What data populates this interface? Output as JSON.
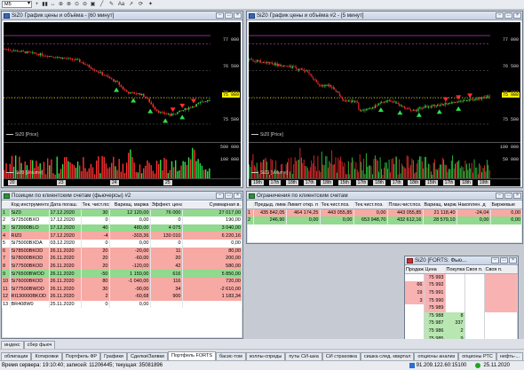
{
  "toolbar": {
    "interval": "M5",
    "tools": [
      "+",
      "▮▮",
      "↔",
      "⊕",
      "⊗",
      "⊙",
      "⊖",
      "▣",
      "╱",
      "✎",
      "Aa",
      "↗",
      "⟳",
      "✦"
    ]
  },
  "colors": {
    "bull": "#2ee04a",
    "bear": "#ff3030",
    "up_row": "#91d98e",
    "down_row": "#f7a9a4",
    "marker": "#fff200",
    "dash_line": "#c04bd0"
  },
  "chart1": {
    "title": "SiZ0 График цены и объёма - [60 минут]",
    "y_ticks": [
      "77 000",
      "76 500",
      "76 000",
      "75 500"
    ],
    "y_tag": "75 989",
    "legend_price": "SiZ0 [Price]",
    "volume_label": "SiZ0 [Volume]",
    "vol_ticks": [
      "500 000",
      "100 000"
    ],
    "x_labels": [
      "20",
      "23",
      "24",
      "25"
    ],
    "chart_data": {
      "type": "candlestick",
      "instrument": "SiZ0",
      "interval": "60 минут",
      "ylim": [
        75300,
        77300
      ],
      "x": [
        "20",
        "23",
        "24",
        "25"
      ],
      "last": 75989
    }
  },
  "chart2": {
    "title": "SiZ0 График цены и объёма #2 - [5 минут]",
    "y_ticks": [
      "77 000",
      "76 500",
      "76 000",
      "75 500"
    ],
    "y_tag": "75 988",
    "legend_price": "SiZ0 [Price]",
    "volume_label": "SiZ0 [Volume]",
    "vol_ticks": [
      "100 000",
      "50 000"
    ],
    "x_labels": [
      "19th",
      "17th",
      "18th",
      "17th",
      "18th",
      "15th",
      "17th",
      "18th",
      "17th",
      "18th",
      "15th",
      "17th",
      "18th",
      "19th"
    ],
    "chart_data": {
      "type": "candlestick",
      "instrument": "SiZ0",
      "interval": "5 минут",
      "ylim": [
        75300,
        77300
      ],
      "last": 75988
    }
  },
  "positions": {
    "title": "Позиции по клиентским счетам (фьючерсы) #2",
    "columns": [
      "Код инструмента",
      "Дата погаш.",
      "Тек. чист.поз.",
      "Вариац. маржа",
      "Эффект. цена",
      "Суммарная в."
    ],
    "rows": [
      {
        "n": "1",
        "code": "SiZ0",
        "date": "17.12.2020",
        "pos": "30",
        "vm": "12 120,00",
        "eff": "76 000",
        "sum": "27 017,00",
        "cls": "g"
      },
      {
        "n": "2",
        "code": "Si72500BXO",
        "date": "17.12.2020",
        "pos": "0",
        "vm": "0,00",
        "eff": "0",
        "sum": "190,00",
        "cls": "w"
      },
      {
        "n": "3",
        "code": "Si72000BLO",
        "date": "17.12.2020",
        "pos": "40",
        "vm": "480,00",
        "eff": "4 075",
        "sum": "3 040,00",
        "cls": "g"
      },
      {
        "n": "4",
        "code": "RIZ0",
        "date": "17.12.2020",
        "pos": "-4",
        "vm": "-303,36",
        "eff": "130 010",
        "sum": "6 220,16",
        "cls": "r"
      },
      {
        "n": "5",
        "code": "Si75000BXDA",
        "date": "03.12.2020",
        "pos": "0",
        "vm": "0,00",
        "eff": "0",
        "sum": "0,00",
        "cls": "w"
      },
      {
        "n": "6",
        "code": "Si78500BKOD",
        "date": "26.11.2020",
        "pos": "20",
        "vm": "-20,00",
        "eff": "11",
        "sum": "80,00",
        "cls": "r"
      },
      {
        "n": "7",
        "code": "Si78000BKOD",
        "date": "26.11.2020",
        "pos": "20",
        "vm": "-60,00",
        "eff": "20",
        "sum": "200,00",
        "cls": "r"
      },
      {
        "n": "8",
        "code": "Si77500BKOD",
        "date": "26.11.2020",
        "pos": "20",
        "vm": "-120,00",
        "eff": "42",
        "sum": "580,00",
        "cls": "r"
      },
      {
        "n": "9",
        "code": "Si76500BWOD",
        "date": "26.11.2020",
        "pos": "-50",
        "vm": "1 150,00",
        "eff": "616",
        "sum": "5 850,00",
        "cls": "g"
      },
      {
        "n": "10",
        "code": "Si76000BKOD",
        "date": "26.11.2020",
        "pos": "80",
        "vm": "-1 040,00",
        "eff": "116",
        "sum": "720,00",
        "cls": "r"
      },
      {
        "n": "11",
        "code": "Si77500BWOD",
        "date": "26.11.2020",
        "pos": "30",
        "vm": "-90,00",
        "eff": "34",
        "sum": "-2 610,00",
        "cls": "r"
      },
      {
        "n": "12",
        "code": "RI130000BKOD",
        "date": "26.11.2020",
        "pos": "2",
        "vm": "-60,68",
        "eff": "900",
        "sum": "1 183,34",
        "cls": "r"
      },
      {
        "n": "13",
        "code": "BR408W0",
        "date": "25.11.2020",
        "pos": "0",
        "vm": "0,00",
        "eff": "",
        "sum": "",
        "cls": "w"
      }
    ]
  },
  "limits": {
    "title": "Ограничения по клиентским счетам",
    "columns": [
      "Предыд. лимит",
      "Лимит откр. п",
      "Тек.чист.поз.",
      "Тек.чист.поз.",
      "План.чист.поз.",
      "Вариац. маржа",
      "Накоплен. д",
      "Биржевые"
    ],
    "rows": [
      {
        "n": "1",
        "c": [
          "435 842,05",
          "464 174,25",
          "443 055,85",
          "0,00",
          "443 055,85",
          "21 118,40",
          "-24,04",
          "0,00",
          "0,00"
        ],
        "cls": "r"
      },
      {
        "n": "2",
        "c": [
          "246,90",
          "0,00",
          "0,00",
          "653 948,70",
          "432 612,16",
          "28 579,10",
          "0,00",
          "0,00"
        ],
        "cls": "g"
      }
    ]
  },
  "glass": {
    "title": "SiZ0 [FORTS: Фью...",
    "columns": [
      "Продаж",
      "Цена",
      "Покупка",
      "Своя п.",
      "Своя п."
    ],
    "rows": [
      {
        "sell": "",
        "price": "75 993",
        "buy": ""
      },
      {
        "sell": "66",
        "price": "75 992",
        "buy": ""
      },
      {
        "sell": "19",
        "price": "75 991",
        "buy": ""
      },
      {
        "sell": "3",
        "price": "75 990",
        "buy": ""
      },
      {
        "sell": "",
        "price": "75 989",
        "buy": ""
      },
      {
        "sell": "",
        "price": "75 988",
        "buy": "8"
      },
      {
        "sell": "",
        "price": "75 987",
        "buy": "337"
      },
      {
        "sell": "",
        "price": "75 986",
        "buy": "2"
      },
      {
        "sell": "",
        "price": "75 985",
        "buy": "9"
      }
    ]
  },
  "tabs_row1": [
    "индекс",
    "сбер фьюч"
  ],
  "tabs_row2": [
    {
      "label": "облигации"
    },
    {
      "label": "Котировки"
    },
    {
      "label": "Портфель ФР"
    },
    {
      "label": "Графики"
    },
    {
      "label": "Сделки/Заявки"
    },
    {
      "label": "Портфель FORTS",
      "active": true
    },
    {
      "label": "басис-том"
    },
    {
      "label": "коллы-спреды"
    },
    {
      "label": "путы СИ-шка"
    },
    {
      "label": "СИ страховка"
    },
    {
      "label": "сишка след. квартал"
    },
    {
      "label": "опционы анализ"
    },
    {
      "label": "опционы РТС"
    },
    {
      "label": "нефть-..."
    }
  ],
  "status": {
    "server_time": "Время сервера: 19:10:40; записей: 11206445; текущая: 35081896",
    "ip": "91.209.122.60:15100",
    "date": "25.11.2020"
  }
}
